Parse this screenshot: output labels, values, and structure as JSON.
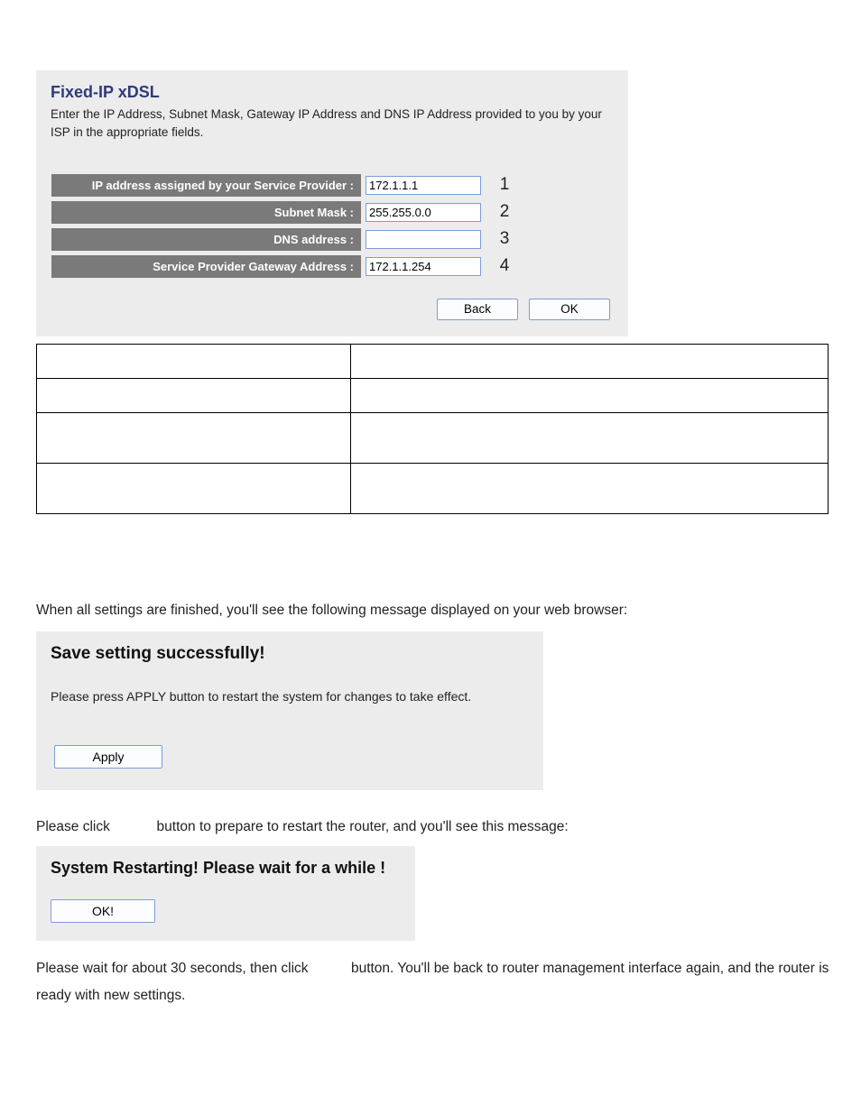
{
  "panel1": {
    "title": "Fixed-IP xDSL",
    "desc": "Enter the IP Address, Subnet Mask, Gateway IP Address and DNS IP Address provided to you by your ISP in the appropriate fields.",
    "rows": [
      {
        "label": "IP address assigned by your Service Provider :",
        "value": "172.1.1.1",
        "num": "1"
      },
      {
        "label": "Subnet Mask :",
        "value": "255.255.0.0",
        "num": "2"
      },
      {
        "label": "DNS address :",
        "value": "",
        "num": "3"
      },
      {
        "label": "Service Provider Gateway Address :",
        "value": "172.1.1.254",
        "num": "4"
      }
    ],
    "back": "Back",
    "ok": "OK"
  },
  "text1": "When all settings are finished, you'll see the following message displayed on your web browser:",
  "panel2": {
    "title": "Save setting successfully!",
    "text": "Please press APPLY button to restart the system for changes to take effect.",
    "apply": "Apply"
  },
  "text2_a": "Please click ",
  "text2_b": " button to prepare to restart the router, and you'll see this message:",
  "panel3": {
    "title": "System Restarting! Please wait for a while !",
    "ok": "OK!"
  },
  "text3_a": "Please wait for about 30 seconds, then click ",
  "text3_b": " button. You'll be back to router management interface again, and the router is ready with new settings."
}
